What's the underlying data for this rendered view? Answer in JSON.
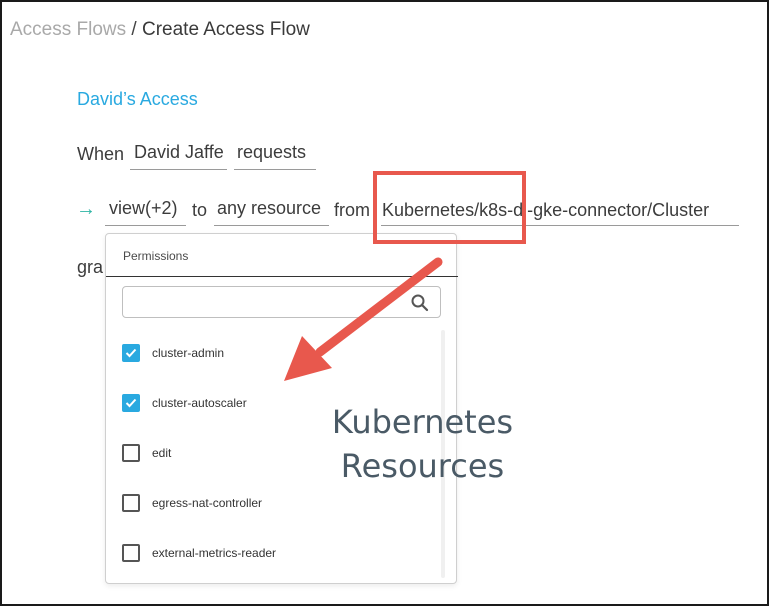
{
  "breadcrumb": {
    "parent": "Access Flows",
    "separator": " / ",
    "current": "Create Access Flow"
  },
  "flow": {
    "name": "David’s Access",
    "when_label": "When",
    "requester": "David Jaffe",
    "requests_label": "requests",
    "permission_chip": "view(+2)",
    "to_label": "to",
    "resource_chip": "any resource",
    "from_label": "from",
    "integration_path": "Kubernetes/k8s-dj-gke-connector/Cluster",
    "grant_label_partial": "gra"
  },
  "permissions_dropdown": {
    "title": "Permissions",
    "search": {
      "value": "",
      "placeholder": ""
    },
    "options": [
      {
        "label": "cluster-admin",
        "checked": true
      },
      {
        "label": "cluster-autoscaler",
        "checked": true
      },
      {
        "label": "edit",
        "checked": false
      },
      {
        "label": "egress-nat-controller",
        "checked": false
      },
      {
        "label": "external-metrics-reader",
        "checked": false
      }
    ]
  },
  "annotation": {
    "text_line1": "Kubernetes",
    "text_line2": "Resources",
    "color": "#e8584d"
  },
  "colors": {
    "accent": "#29a9e0",
    "arrow_teal": "#2fb5a5",
    "callout_red": "#e8584d"
  },
  "icons": {
    "flow_arrow": "arrow-right-icon",
    "search": "search-icon",
    "checkbox": "checkbox-icon"
  }
}
